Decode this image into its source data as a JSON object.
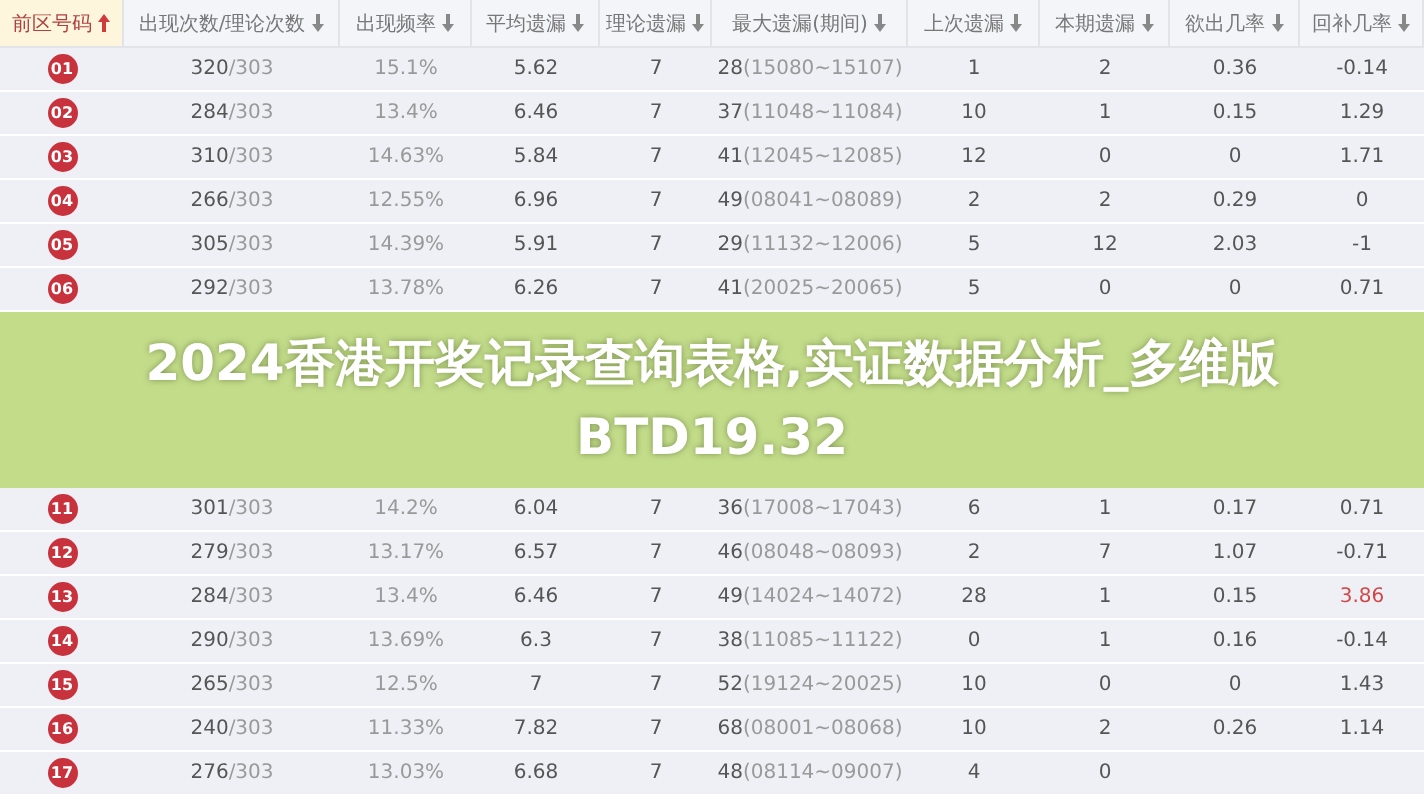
{
  "table": {
    "columns": [
      {
        "label": "前区号码",
        "sorted": true
      },
      {
        "label": "出现次数/理论次数",
        "sorted": false
      },
      {
        "label": "出现频率",
        "sorted": false
      },
      {
        "label": "平均遗漏",
        "sorted": false
      },
      {
        "label": "理论遗漏",
        "sorted": false
      },
      {
        "label": "最大遗漏(期间)",
        "sorted": false
      },
      {
        "label": "上次遗漏",
        "sorted": false
      },
      {
        "label": "本期遗漏",
        "sorted": false
      },
      {
        "label": "欲出几率",
        "sorted": false
      },
      {
        "label": "回补几率",
        "sorted": false
      }
    ],
    "rows_above": [
      {
        "number": "01",
        "count": "320",
        "theory": "/303",
        "frequency": "15.1%",
        "avg_miss": "5.62",
        "theory_miss": "7",
        "max_miss": "28",
        "max_period": "(15080~15107)",
        "last_miss": "1",
        "current_miss": "2",
        "odds": "0.36",
        "rebound": "-0.14",
        "rebound_alert": false
      },
      {
        "number": "02",
        "count": "284",
        "theory": "/303",
        "frequency": "13.4%",
        "avg_miss": "6.46",
        "theory_miss": "7",
        "max_miss": "37",
        "max_period": "(11048~11084)",
        "last_miss": "10",
        "current_miss": "1",
        "odds": "0.15",
        "rebound": "1.29",
        "rebound_alert": false
      },
      {
        "number": "03",
        "count": "310",
        "theory": "/303",
        "frequency": "14.63%",
        "avg_miss": "5.84",
        "theory_miss": "7",
        "max_miss": "41",
        "max_period": "(12045~12085)",
        "last_miss": "12",
        "current_miss": "0",
        "odds": "0",
        "rebound": "1.71",
        "rebound_alert": false
      },
      {
        "number": "04",
        "count": "266",
        "theory": "/303",
        "frequency": "12.55%",
        "avg_miss": "6.96",
        "theory_miss": "7",
        "max_miss": "49",
        "max_period": "(08041~08089)",
        "last_miss": "2",
        "current_miss": "2",
        "odds": "0.29",
        "rebound": "0",
        "rebound_alert": false
      },
      {
        "number": "05",
        "count": "305",
        "theory": "/303",
        "frequency": "14.39%",
        "avg_miss": "5.91",
        "theory_miss": "7",
        "max_miss": "29",
        "max_period": "(11132~12006)",
        "last_miss": "5",
        "current_miss": "12",
        "odds": "2.03",
        "rebound": "-1",
        "rebound_alert": false
      },
      {
        "number": "06",
        "count": "292",
        "theory": "/303",
        "frequency": "13.78%",
        "avg_miss": "6.26",
        "theory_miss": "7",
        "max_miss": "41",
        "max_period": "(20025~20065)",
        "last_miss": "5",
        "current_miss": "0",
        "odds": "0",
        "rebound": "0.71",
        "rebound_alert": false
      }
    ],
    "rows_below": [
      {
        "number": "11",
        "count": "301",
        "theory": "/303",
        "frequency": "14.2%",
        "avg_miss": "6.04",
        "theory_miss": "7",
        "max_miss": "36",
        "max_period": "(17008~17043)",
        "last_miss": "6",
        "current_miss": "1",
        "odds": "0.17",
        "rebound": "0.71",
        "rebound_alert": false
      },
      {
        "number": "12",
        "count": "279",
        "theory": "/303",
        "frequency": "13.17%",
        "avg_miss": "6.57",
        "theory_miss": "7",
        "max_miss": "46",
        "max_period": "(08048~08093)",
        "last_miss": "2",
        "current_miss": "7",
        "odds": "1.07",
        "rebound": "-0.71",
        "rebound_alert": false
      },
      {
        "number": "13",
        "count": "284",
        "theory": "/303",
        "frequency": "13.4%",
        "avg_miss": "6.46",
        "theory_miss": "7",
        "max_miss": "49",
        "max_period": "(14024~14072)",
        "last_miss": "28",
        "current_miss": "1",
        "odds": "0.15",
        "rebound": "3.86",
        "rebound_alert": true
      },
      {
        "number": "14",
        "count": "290",
        "theory": "/303",
        "frequency": "13.69%",
        "avg_miss": "6.3",
        "theory_miss": "7",
        "max_miss": "38",
        "max_period": "(11085~11122)",
        "last_miss": "0",
        "current_miss": "1",
        "odds": "0.16",
        "rebound": "-0.14",
        "rebound_alert": false
      },
      {
        "number": "15",
        "count": "265",
        "theory": "/303",
        "frequency": "12.5%",
        "avg_miss": "7",
        "theory_miss": "7",
        "max_miss": "52",
        "max_period": "(19124~20025)",
        "last_miss": "10",
        "current_miss": "0",
        "odds": "0",
        "rebound": "1.43",
        "rebound_alert": false
      },
      {
        "number": "16",
        "count": "240",
        "theory": "/303",
        "frequency": "11.33%",
        "avg_miss": "7.82",
        "theory_miss": "7",
        "max_miss": "68",
        "max_period": "(08001~08068)",
        "last_miss": "10",
        "current_miss": "2",
        "odds": "0.26",
        "rebound": "1.14",
        "rebound_alert": false
      },
      {
        "number": "17",
        "count": "276",
        "theory": "/303",
        "frequency": "13.03%",
        "avg_miss": "6.68",
        "theory_miss": "7",
        "max_miss": "48",
        "max_period": "(08114~09007)",
        "last_miss": "4",
        "current_miss": "0"
      }
    ]
  },
  "banner": {
    "title": "2024香港开奖记录查询表格,实证数据分析_多维版BTD19.32"
  }
}
